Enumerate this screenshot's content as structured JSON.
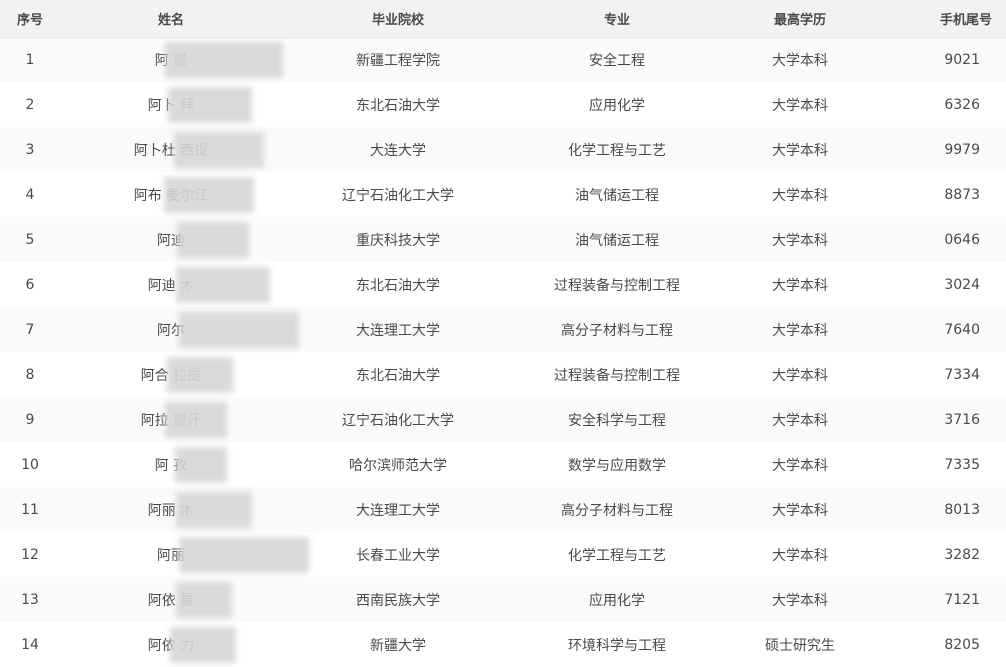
{
  "columns": {
    "index": "序号",
    "name": "姓名",
    "school": "毕业院校",
    "major": "专业",
    "education": "最高学历",
    "phone_tail": "手机尾号"
  },
  "rows": [
    {
      "index": "1",
      "name": "阿 提",
      "school": "新疆工程学院",
      "major": "安全工程",
      "education": "大学本科",
      "phone_tail": "9021"
    },
    {
      "index": "2",
      "name": "阿卜 拜",
      "school": "东北石油大学",
      "major": "应用化学",
      "education": "大学本科",
      "phone_tail": "6326"
    },
    {
      "index": "3",
      "name": "阿卜杜 西提",
      "school": "大连大学",
      "major": "化学工程与工艺",
      "education": "大学本科",
      "phone_tail": "9979"
    },
    {
      "index": "4",
      "name": "阿布 麦尔江",
      "school": "辽宁石油化工大学",
      "major": "油气储运工程",
      "education": "大学本科",
      "phone_tail": "8873"
    },
    {
      "index": "5",
      "name": "阿迪",
      "school": "重庆科技大学",
      "major": "油气储运工程",
      "education": "大学本科",
      "phone_tail": "0646"
    },
    {
      "index": "6",
      "name": "阿迪 木",
      "school": "东北石油大学",
      "major": "过程装备与控制工程",
      "education": "大学本科",
      "phone_tail": "3024"
    },
    {
      "index": "7",
      "name": "阿尔",
      "school": "大连理工大学",
      "major": "高分子材料与工程",
      "education": "大学本科",
      "phone_tail": "7640"
    },
    {
      "index": "8",
      "name": "阿合 拉提",
      "school": "东北石油大学",
      "major": "过程装备与控制工程",
      "education": "大学本科",
      "phone_tail": "7334"
    },
    {
      "index": "9",
      "name": "阿拉 提汗",
      "school": "辽宁石油化工大学",
      "major": "安全科学与工程",
      "education": "大学本科",
      "phone_tail": "3716"
    },
    {
      "index": "10",
      "name": "阿 孜",
      "school": "哈尔滨师范大学",
      "major": "数学与应用数学",
      "education": "大学本科",
      "phone_tail": "7335"
    },
    {
      "index": "11",
      "name": "阿丽 木",
      "school": "大连理工大学",
      "major": "高分子材料与工程",
      "education": "大学本科",
      "phone_tail": "8013"
    },
    {
      "index": "12",
      "name": "阿丽",
      "school": "长春工业大学",
      "major": "化学工程与工艺",
      "education": "大学本科",
      "phone_tail": "3282"
    },
    {
      "index": "13",
      "name": "阿依 曼",
      "school": "西南民族大学",
      "major": "应用化学",
      "education": "大学本科",
      "phone_tail": "7121"
    },
    {
      "index": "14",
      "name": "阿依 力",
      "school": "新疆大学",
      "major": "环境科学与工程",
      "education": "硕士研究生",
      "phone_tail": "8205"
    }
  ]
}
